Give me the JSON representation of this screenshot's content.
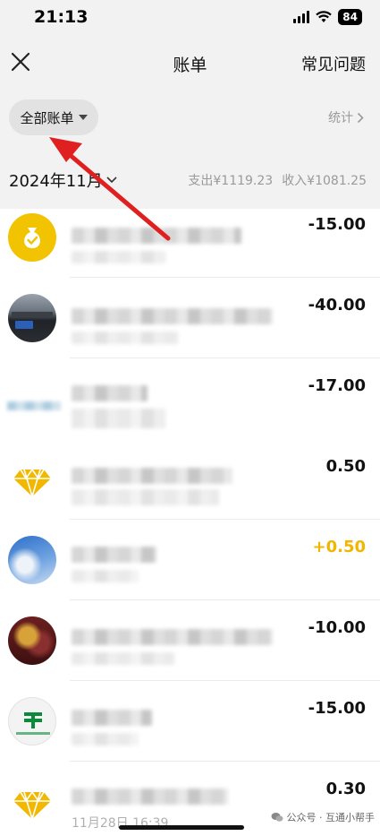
{
  "status_bar": {
    "time": "21:13",
    "battery": "84"
  },
  "nav": {
    "title": "账单",
    "faq": "常见问题"
  },
  "filter": {
    "label": "全部账单",
    "stats": "统计"
  },
  "month": {
    "label": "2024年11月",
    "expense": "支出¥1119.23",
    "income": "收入¥1081.25"
  },
  "transactions": [
    {
      "amount": "-15.00",
      "icon": "moneybag-icon",
      "color": "#f2c300"
    },
    {
      "amount": "-40.00",
      "icon": "car-photo-avatar"
    },
    {
      "amount": "-17.00",
      "icon": "blurred-logo"
    },
    {
      "amount": "0.50",
      "icon": "diamond-icon",
      "color": "#f2b800"
    },
    {
      "amount": "+0.50",
      "icon": "sky-photo-avatar",
      "color": "#f2b600"
    },
    {
      "amount": "-10.00",
      "icon": "food-photo-avatar"
    },
    {
      "amount": "-15.00",
      "icon": "post-office-logo",
      "color": "#0a8a3a"
    },
    {
      "amount": "0.30",
      "icon": "diamond-icon",
      "color": "#f2b800"
    }
  ],
  "last_date": "11月28日 16:39",
  "watermark": "公众号 · 互通小帮手",
  "colors": {
    "accent_yellow": "#f2c300",
    "arrow_red": "#e02020"
  }
}
